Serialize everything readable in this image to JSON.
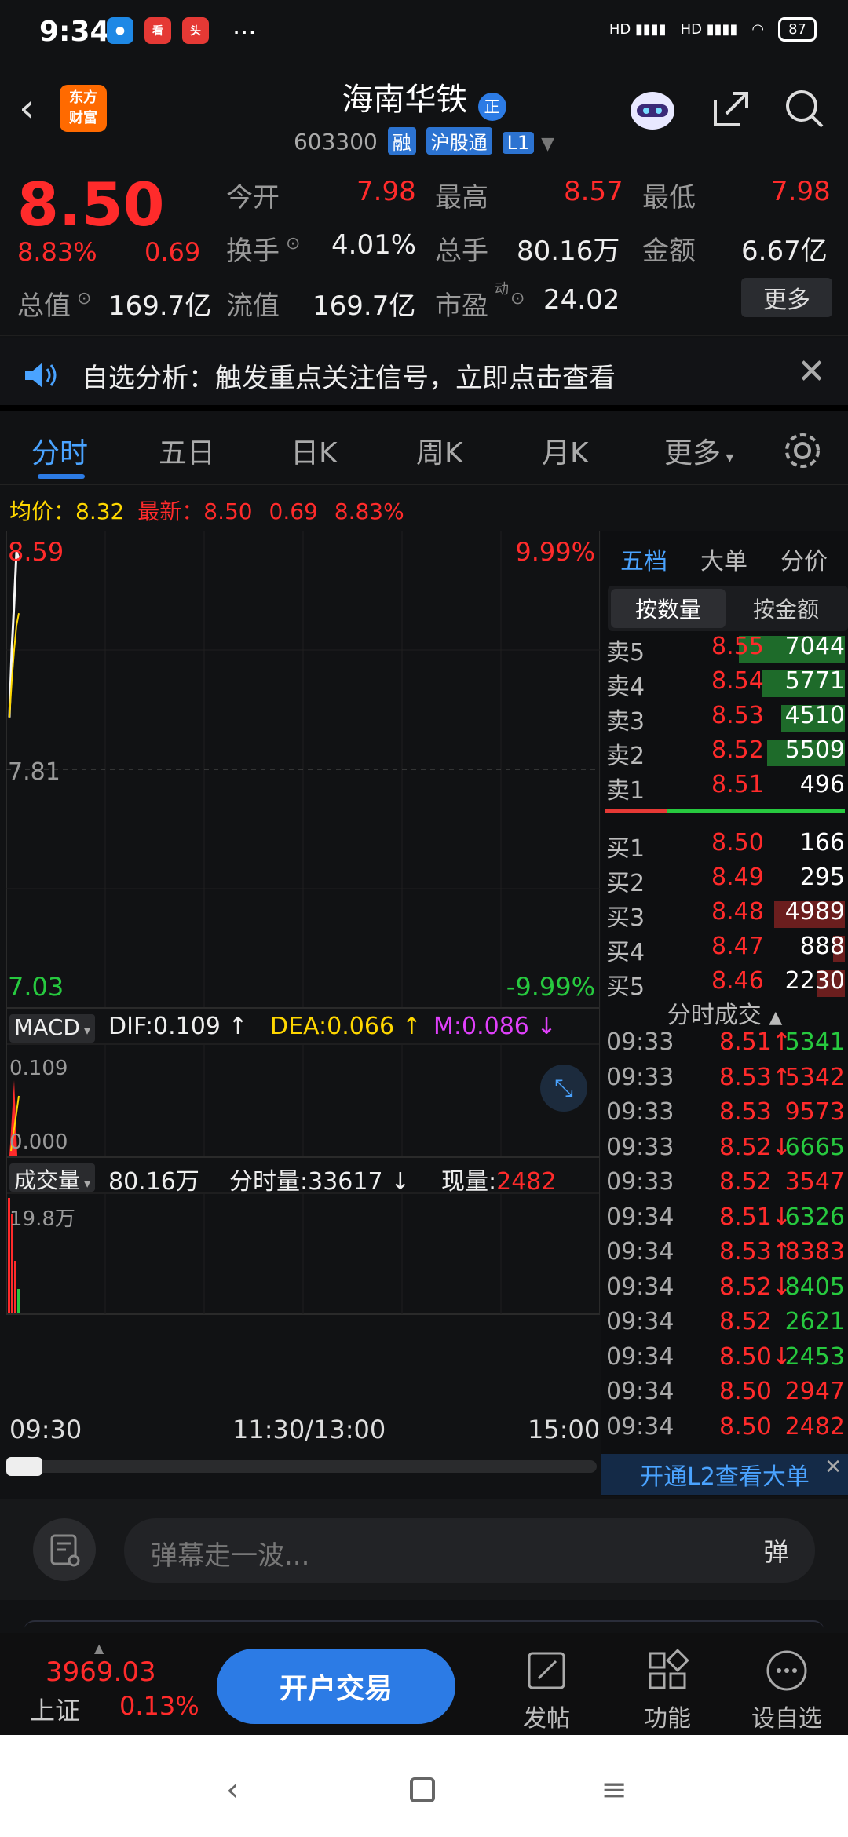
{
  "status": {
    "time": "9:34",
    "apps": [
      "app1",
      "app2",
      "app3"
    ],
    "net": "HD",
    "battery": "87"
  },
  "header": {
    "logo": "东方\n财富",
    "stock_name": "海南华铁",
    "name_badge": "正",
    "code": "603300",
    "tags": [
      "融",
      "沪股通",
      "L1"
    ]
  },
  "quote": {
    "price": "8.50",
    "change_pct": "8.83%",
    "change": "0.69",
    "rows": [
      [
        {
          "label": "今开",
          "value": "7.98",
          "color": "red"
        },
        {
          "label": "最高",
          "value": "8.57",
          "color": "red"
        },
        {
          "label": "最低",
          "value": "7.98",
          "color": "red"
        }
      ],
      [
        {
          "label": "换手",
          "value": "4.01%",
          "color": "white"
        },
        {
          "label": "总手",
          "value": "80.16万",
          "color": "white"
        },
        {
          "label": "金额",
          "value": "6.67亿",
          "color": "white"
        }
      ],
      [
        {
          "label": "总值",
          "value": "169.7亿",
          "color": "white"
        },
        {
          "label": "流值",
          "value": "169.7亿",
          "color": "white"
        },
        {
          "label": "市盈",
          "value": "24.02",
          "color": "white"
        }
      ]
    ],
    "pe_sup": "动",
    "more_label": "更多"
  },
  "notice": {
    "text": "自选分析：触发重点关注信号，立即点击查看"
  },
  "tabs": [
    "分时",
    "五日",
    "日K",
    "周K",
    "月K",
    "更多"
  ],
  "avg_line": {
    "avg_label": "均价：",
    "avg_value": "8.32",
    "latest_label": "最新：",
    "latest_value": "8.50",
    "latest_change": "0.69",
    "latest_pct": "8.83%"
  },
  "chart_data": {
    "type": "line",
    "price_axis": {
      "top": "8.59",
      "mid": "7.81",
      "bottom": "7.03",
      "top_pct": "9.99%",
      "bottom_pct": "-9.99%"
    },
    "price_series": [
      7.98,
      8.2,
      8.35,
      8.52,
      8.5
    ],
    "avg_series": [
      7.98,
      8.1,
      8.2,
      8.28,
      8.32
    ],
    "macd": {
      "label": "MACD",
      "dif": "DIF:0.109",
      "dea": "DEA:0.066",
      "m": "M:0.086",
      "top": "0.109",
      "bottom": "0.000"
    },
    "volume": {
      "label": "成交量",
      "total": "80.16万",
      "fs_label": "分时量:",
      "fs_value": "33617",
      "now_label": "现量:",
      "now_value": "2482",
      "max": "19.8万"
    },
    "time_axis": [
      "09:30",
      "11:30/13:00",
      "15:00"
    ]
  },
  "right_panel": {
    "tabs": [
      "五档",
      "大单",
      "分价"
    ],
    "sub_tabs": [
      "按数量",
      "按金额"
    ],
    "asks": [
      {
        "label": "卖5",
        "price": "8.55",
        "vol": "7044",
        "fill": 0.45
      },
      {
        "label": "卖4",
        "price": "8.54",
        "vol": "5771",
        "fill": 0.35
      },
      {
        "label": "卖3",
        "price": "8.53",
        "vol": "4510",
        "fill": 0.27
      },
      {
        "label": "卖2",
        "price": "8.52",
        "vol": "5509",
        "fill": 0.33
      },
      {
        "label": "卖1",
        "price": "8.51",
        "vol": "496",
        "fill": 0.0
      }
    ],
    "bids": [
      {
        "label": "买1",
        "price": "8.50",
        "vol": "166",
        "fill": 0.0
      },
      {
        "label": "买2",
        "price": "8.49",
        "vol": "295",
        "fill": 0.0
      },
      {
        "label": "买3",
        "price": "8.48",
        "vol": "4989",
        "fill": 0.3
      },
      {
        "label": "买4",
        "price": "8.47",
        "vol": "888",
        "fill": 0.05
      },
      {
        "label": "买5",
        "price": "8.46",
        "vol": "2230",
        "fill": 0.12
      }
    ],
    "trades_title": "分时成交",
    "trades": [
      {
        "time": "09:33",
        "price": "8.51↑",
        "vol": "5341",
        "pc": "red",
        "vc": "green"
      },
      {
        "time": "09:33",
        "price": "8.53↑",
        "vol": "5342",
        "pc": "red",
        "vc": "red"
      },
      {
        "time": "09:33",
        "price": "8.53",
        "vol": "9573",
        "pc": "red",
        "vc": "red"
      },
      {
        "time": "09:33",
        "price": "8.52↓",
        "vol": "6665",
        "pc": "red",
        "vc": "green"
      },
      {
        "time": "09:33",
        "price": "8.52",
        "vol": "3547",
        "pc": "red",
        "vc": "red"
      },
      {
        "time": "09:34",
        "price": "8.51↓",
        "vol": "6326",
        "pc": "red",
        "vc": "green"
      },
      {
        "time": "09:34",
        "price": "8.53↑",
        "vol": "8383",
        "pc": "red",
        "vc": "red"
      },
      {
        "time": "09:34",
        "price": "8.52↓",
        "vol": "8405",
        "pc": "red",
        "vc": "green"
      },
      {
        "time": "09:34",
        "price": "8.52",
        "vol": "2621",
        "pc": "red",
        "vc": "green"
      },
      {
        "time": "09:34",
        "price": "8.50↓",
        "vol": "2453",
        "pc": "red",
        "vc": "green"
      },
      {
        "time": "09:34",
        "price": "8.50",
        "vol": "2947",
        "pc": "red",
        "vc": "red"
      },
      {
        "time": "09:34",
        "price": "8.50",
        "vol": "2482",
        "pc": "red",
        "vc": "red"
      }
    ],
    "l2_text": "开通L2查看大单"
  },
  "danmu": {
    "placeholder": "弹幕走一波...",
    "btn": "弹"
  },
  "bottom": {
    "index_value": "3969.03",
    "index_name": "上证",
    "index_change": "0.13%",
    "trade_label": "开户交易",
    "items": [
      "发帖",
      "功能",
      "设自选"
    ]
  }
}
